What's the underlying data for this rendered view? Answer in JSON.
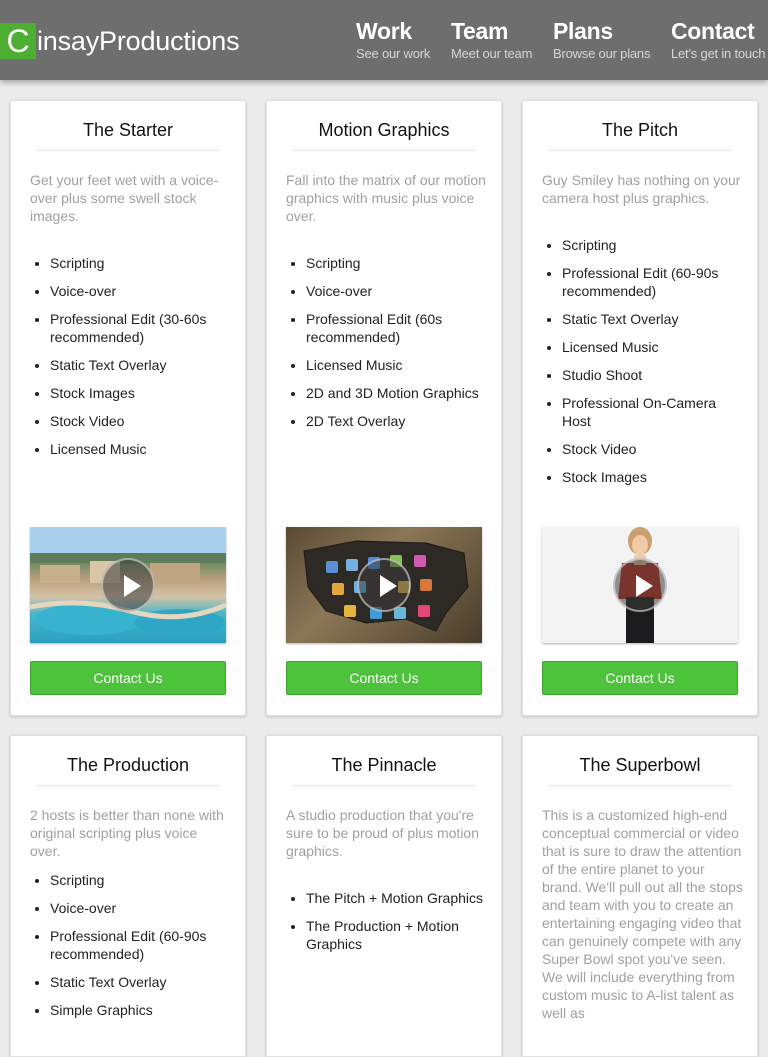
{
  "header": {
    "logo_letter": "C",
    "logo_text": "insayProductions",
    "nav": [
      {
        "label": "Work",
        "sub": "See our work"
      },
      {
        "label": "Team",
        "sub": "Meet our team"
      },
      {
        "label": "Plans",
        "sub": "Browse our plans"
      },
      {
        "label": "Contact",
        "sub": "Let's get in touch"
      }
    ]
  },
  "cards": [
    {
      "title": "The Starter",
      "description": "Get your feet wet with a voice-over plus some swell stock images.",
      "features": [
        "Scripting",
        "Voice-over",
        "Professional Edit (30-60s recommended)",
        "Static Text Overlay",
        "Stock Images",
        "Stock Video",
        "Licensed Music"
      ],
      "button": "Contact Us"
    },
    {
      "title": "Motion Graphics",
      "description": "Fall into the matrix of our motion graphics with music plus voice over.",
      "features": [
        "Scripting",
        "Voice-over",
        "Professional Edit (60s recommended)",
        "Licensed Music",
        "2D and 3D Motion Graphics",
        "2D Text Overlay"
      ],
      "button": "Contact Us"
    },
    {
      "title": "The Pitch",
      "description": "Guy Smiley has nothing on your camera host plus graphics.",
      "features": [
        "Scripting",
        "Professional Edit (60-90s recommended)",
        "Static Text Overlay",
        "Licensed Music",
        "Studio Shoot",
        "Professional On-Camera Host",
        "Stock Video",
        "Stock Images"
      ],
      "button": "Contact Us"
    },
    {
      "title": "The Production",
      "description": "2 hosts is better than none with original scripting plus voice over.",
      "features": [
        "Scripting",
        "Voice-over",
        "Professional Edit (60-90s recommended)",
        "Static Text Overlay",
        "Simple Graphics"
      ]
    },
    {
      "title": "The Pinnacle",
      "description": "A studio production that you're sure to be proud of plus motion graphics.",
      "features": [
        "The Pitch + Motion Graphics",
        "The Production + Motion Graphics"
      ]
    },
    {
      "title": "The Superbowl",
      "description": "This is a customized high-end conceptual commercial or video that is sure to draw the attention of the entire planet to your brand. We'll pull out all the stops and team with you to create an entertaining engaging video that can genuinely compete with any Super Bowl spot you've seen. We will include everything from custom music to A-list talent as well as"
    }
  ],
  "colors": {
    "header_bg": "#6e6e6e",
    "logo_green": "#4caf32",
    "button_green": "#4cc33a",
    "page_bg": "#ececec"
  }
}
